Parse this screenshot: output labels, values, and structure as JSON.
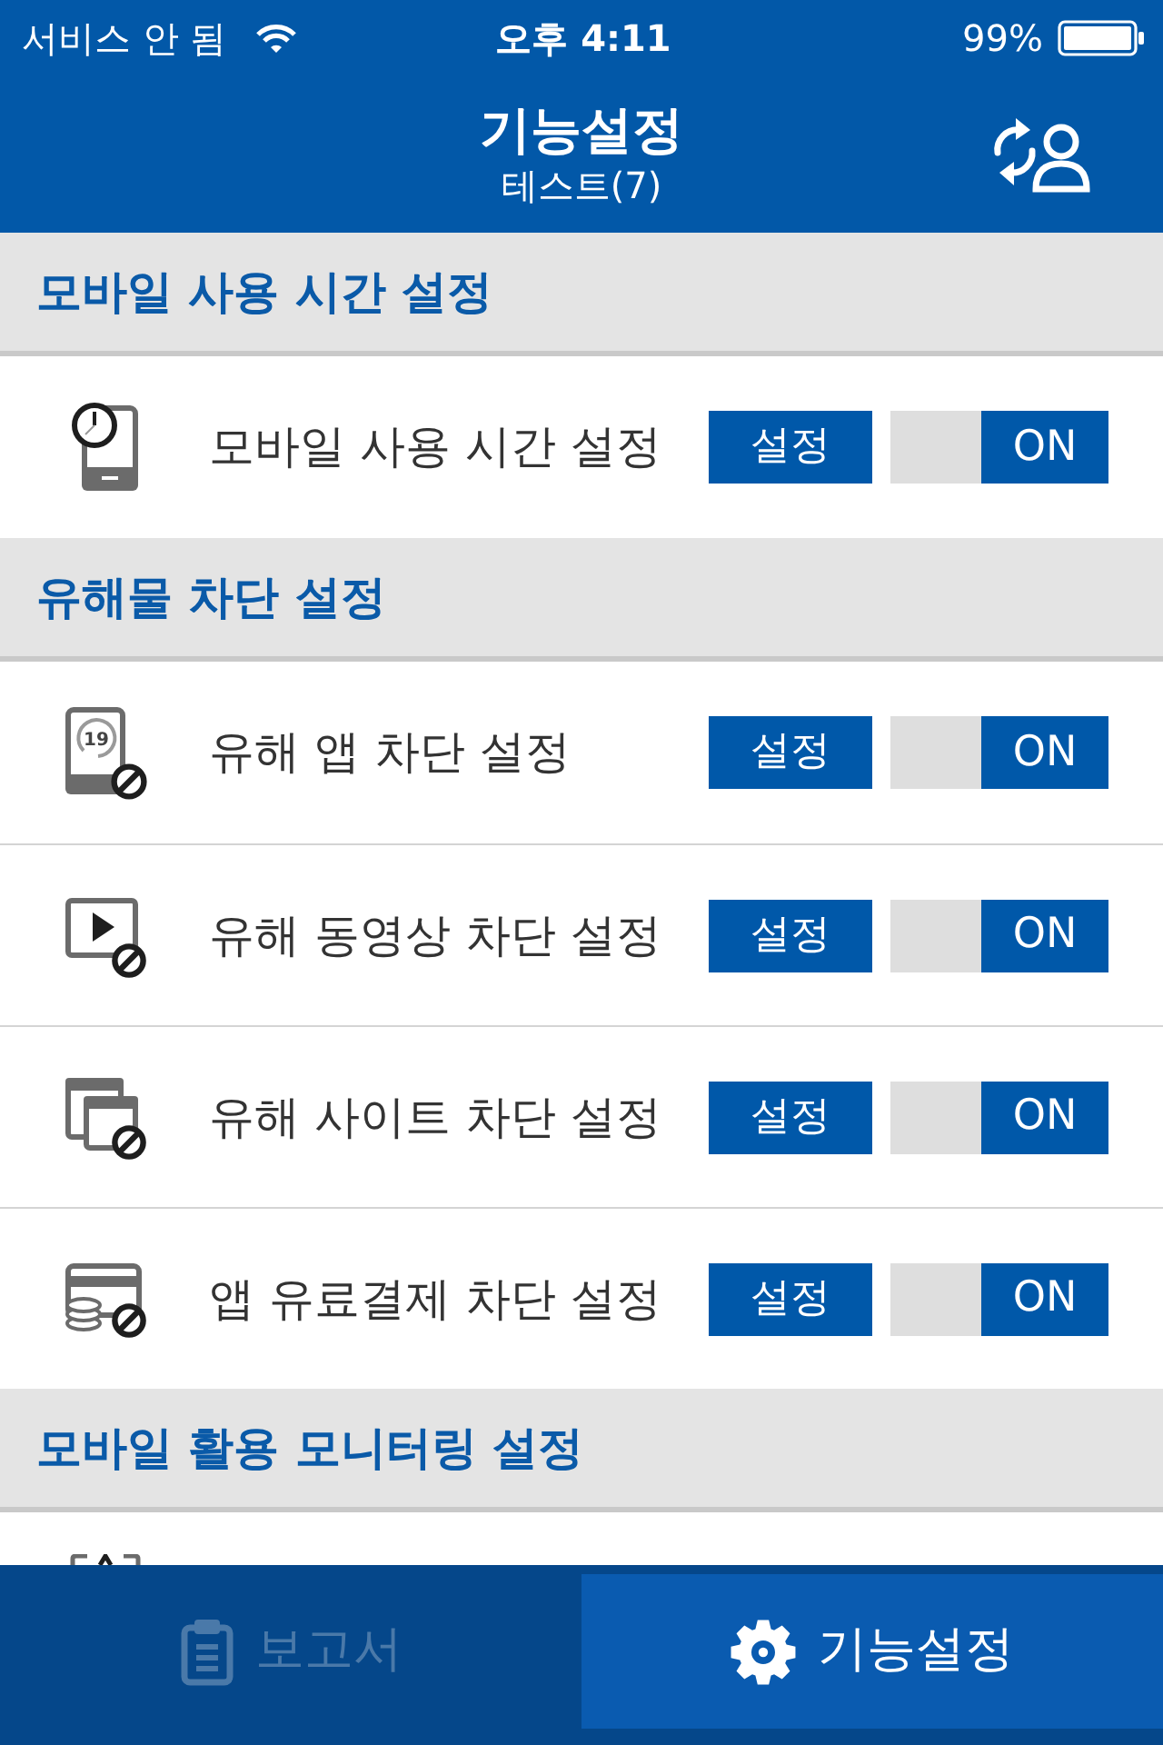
{
  "status_bar": {
    "carrier": "서비스 안 됨",
    "time": "오후 4:11",
    "battery": "99%"
  },
  "header": {
    "title": "기능설정",
    "subtitle": "테스트(7)"
  },
  "sections": [
    {
      "title": "모바일 사용 시간 설정",
      "items": [
        {
          "kind": "setting",
          "label": "모바일 사용 시간 설정",
          "button": "설정",
          "switch_label": "ON",
          "on": true
        }
      ]
    },
    {
      "title": "유해물 차단 설정",
      "items": [
        {
          "kind": "setting",
          "label": "유해 앱 차단 설정",
          "icon_text": "19",
          "button": "설정",
          "switch_label": "ON",
          "on": true
        },
        {
          "kind": "setting",
          "label": "유해 동영상 차단 설정",
          "button": "설정",
          "switch_label": "ON",
          "on": true
        },
        {
          "kind": "setting",
          "label": "유해 사이트 차단 설정",
          "button": "설정",
          "switch_label": "ON",
          "on": true
        },
        {
          "kind": "setting",
          "label": "앱 유료결제 차단 설정",
          "button": "설정",
          "switch_label": "ON",
          "on": true
        }
      ]
    },
    {
      "title": "모바일 활용 모니터링 설정",
      "items": [
        {
          "kind": "clipped"
        }
      ]
    }
  ],
  "tabs": [
    {
      "label": "보고서",
      "selected": false
    },
    {
      "label": "기능설정",
      "selected": true
    }
  ]
}
